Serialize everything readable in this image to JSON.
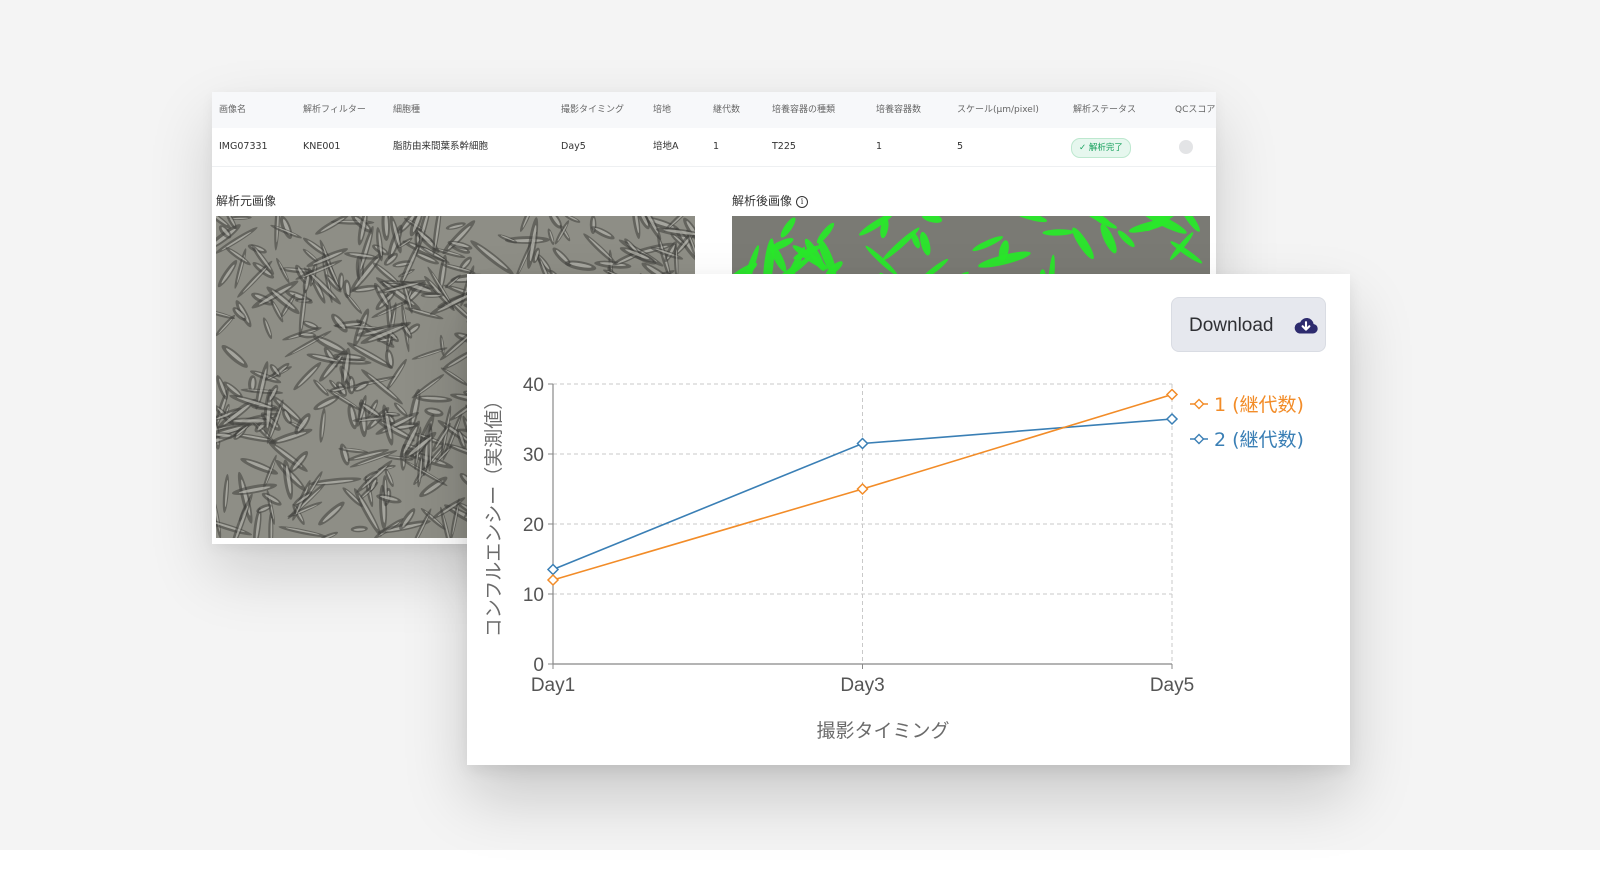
{
  "table": {
    "columns": [
      "画像名",
      "解析フィルター",
      "細胞種",
      "撮影タイミング",
      "培地",
      "継代数",
      "培養容器の種類",
      "培養容器数",
      "スケール(μm/pixel)",
      "解析ステータス",
      "QCスコア"
    ],
    "row": {
      "image_name": "IMG07331",
      "filter": "KNE001",
      "cell_type": "脂肪由来間葉系幹細胞",
      "timing": "Day5",
      "medium": "培地A",
      "passage": "1",
      "vessel_type": "T225",
      "vessel_count": "1",
      "scale": "5",
      "status": "✓ 解析完了"
    }
  },
  "images": {
    "original_label": "解析元画像",
    "analyzed_label": "解析後画像",
    "info_icon": "i"
  },
  "download": {
    "label": "Download",
    "icon": "cloud-download-icon"
  },
  "colors": {
    "series1": "#f28c28",
    "series2": "#3a7fb5",
    "status_green": "#14a05b",
    "mask_green": "#29e82a",
    "download_icon": "#2d2b6e"
  },
  "chart_data": {
    "type": "line",
    "categories": [
      "Day1",
      "Day3",
      "Day5"
    ],
    "series": [
      {
        "name": "1 (継代数)",
        "values": [
          12,
          25,
          38.5
        ]
      },
      {
        "name": "2 (継代数)",
        "values": [
          13.5,
          31.5,
          35
        ]
      }
    ],
    "xlabel": "撮影タイミング",
    "ylabel": "コンフルエンシー（実測値）",
    "yticks": [
      0,
      10,
      20,
      30,
      40
    ],
    "ylim": [
      0,
      40
    ],
    "grid": true,
    "legend_position": "right"
  }
}
